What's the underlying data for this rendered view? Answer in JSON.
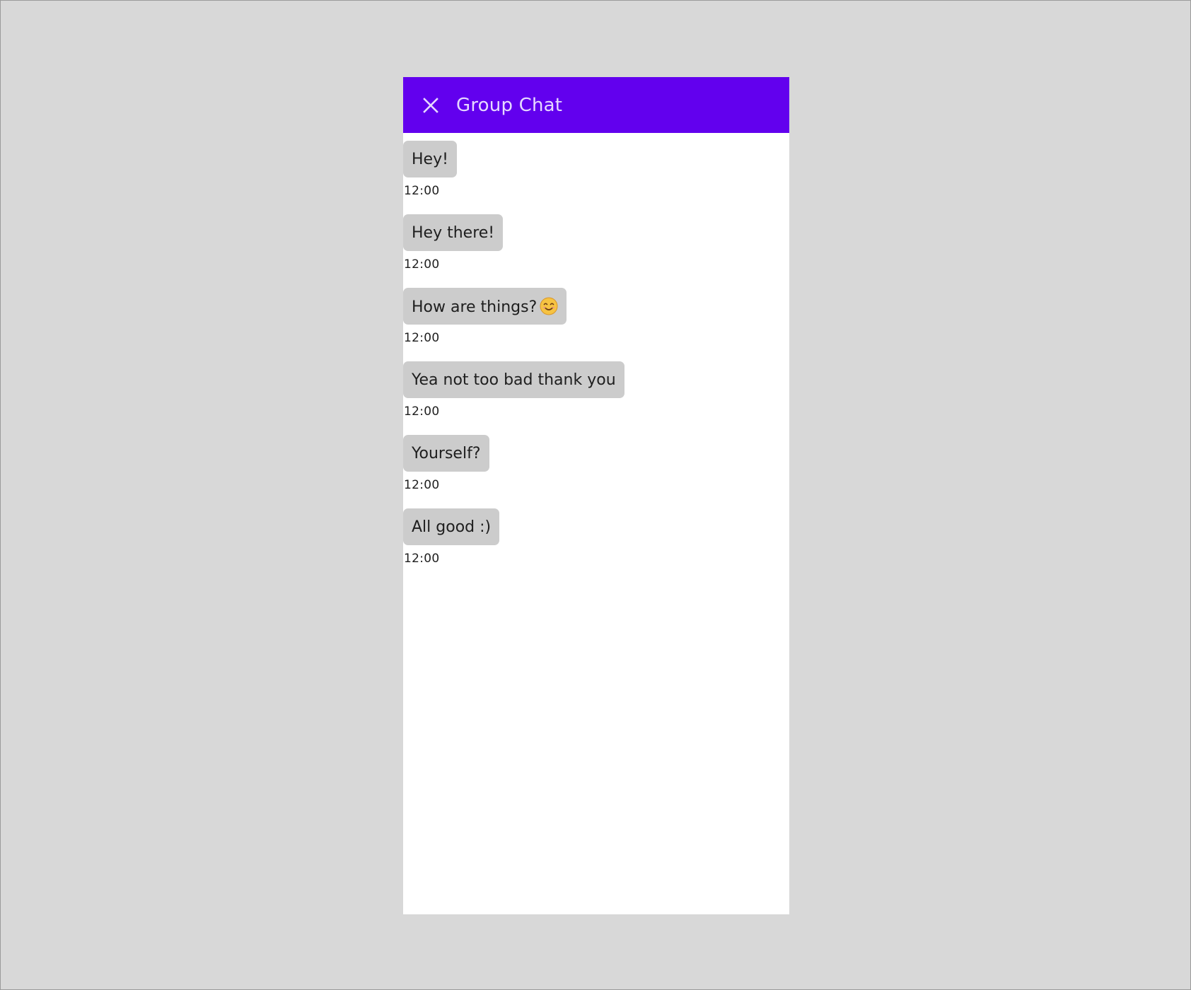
{
  "header": {
    "title": "Group Chat",
    "close_icon": "close-icon"
  },
  "colors": {
    "app_bar": "#6200ee",
    "app_bar_text": "#e6d8ff",
    "bubble": "#cccccc",
    "canvas": "#d8d8d8"
  },
  "messages": [
    {
      "text": "Hey!",
      "time": "12:00"
    },
    {
      "text": "Hey there!",
      "time": "12:00"
    },
    {
      "text": "How are things?",
      "emoji": "smiling-face-emoji",
      "time": "12:00"
    },
    {
      "text": "Yea not too bad thank you",
      "time": "12:00"
    },
    {
      "text": "Yourself?",
      "time": "12:00"
    },
    {
      "text": "All good :)",
      "time": "12:00"
    }
  ]
}
